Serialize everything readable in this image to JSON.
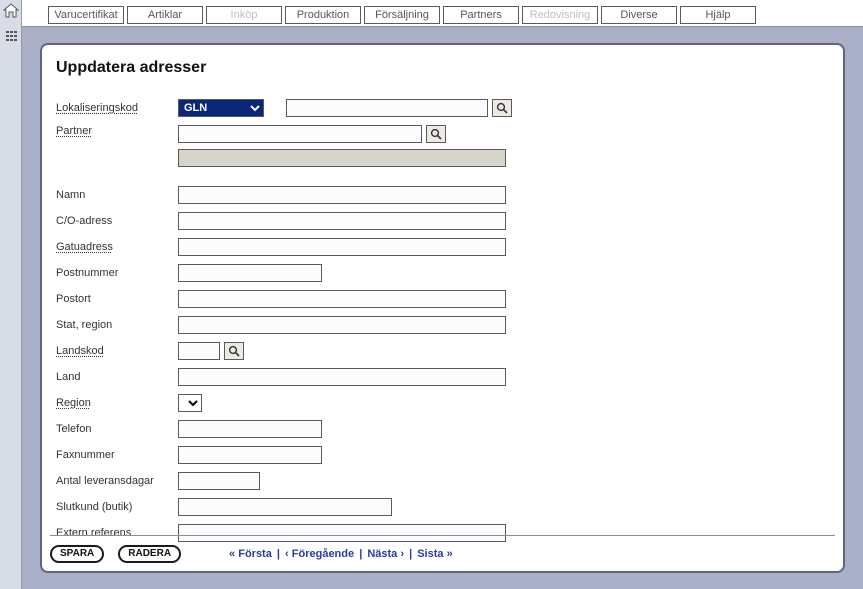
{
  "tabs": [
    {
      "label": "Varucertifikat",
      "disabled": false
    },
    {
      "label": "Artiklar",
      "disabled": false
    },
    {
      "label": "Inköp",
      "disabled": true
    },
    {
      "label": "Produktion",
      "disabled": false
    },
    {
      "label": "Försäljning",
      "disabled": false
    },
    {
      "label": "Partners",
      "disabled": false
    },
    {
      "label": "Redovisning",
      "disabled": true
    },
    {
      "label": "Diverse",
      "disabled": false
    },
    {
      "label": "Hjälp",
      "disabled": false
    }
  ],
  "page": {
    "title": "Uppdatera adresser"
  },
  "form": {
    "lokaliseringskod": {
      "label": "Lokaliseringskod",
      "select_value": "GLN",
      "input_value": ""
    },
    "partner": {
      "label": "Partner",
      "value": "",
      "readonly_value": ""
    },
    "namn": {
      "label": "Namn",
      "value": ""
    },
    "co_adress": {
      "label": "C/O-adress",
      "value": ""
    },
    "gatuadress": {
      "label": "Gatuadress",
      "value": ""
    },
    "postnummer": {
      "label": "Postnummer",
      "value": ""
    },
    "postort": {
      "label": "Postort",
      "value": ""
    },
    "stat_region": {
      "label": "Stat, region",
      "value": ""
    },
    "landskod": {
      "label": "Landskod",
      "value": ""
    },
    "land": {
      "label": "Land",
      "value": ""
    },
    "region": {
      "label": "Region",
      "value": ""
    },
    "telefon": {
      "label": "Telefon",
      "value": ""
    },
    "faxnummer": {
      "label": "Faxnummer",
      "value": ""
    },
    "antal_leveransdagar": {
      "label": "Antal leveransdagar",
      "value": ""
    },
    "slutkund": {
      "label": "Slutkund (butik)",
      "value": ""
    },
    "extern_referens": {
      "label": "Extern referens",
      "value": ""
    }
  },
  "footer": {
    "save": "SPARA",
    "delete": "RADERA",
    "first": "« Första",
    "prev": "‹ Föregående",
    "next": "Nästa ›",
    "last": "Sista »"
  }
}
